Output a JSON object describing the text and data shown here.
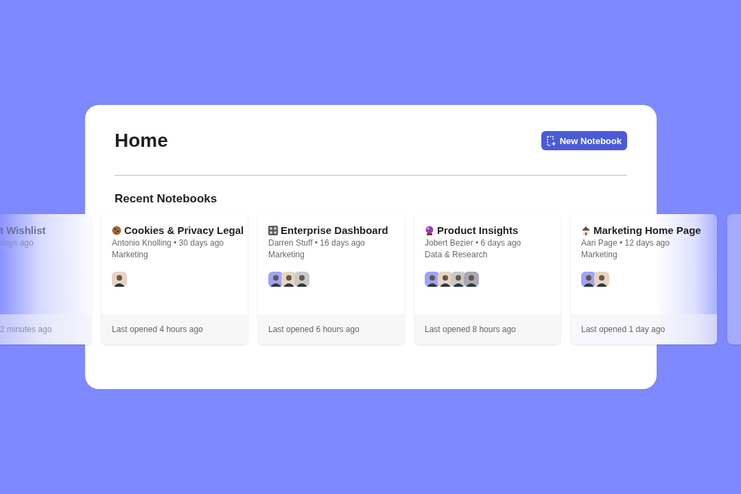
{
  "page": {
    "title": "Home",
    "new_button": "New Notebook"
  },
  "section_title": "Recent Notebooks",
  "notebooks": [
    {
      "kind": "partial-left",
      "title": "t Wishlist",
      "meta": "days ago",
      "opened": "2 minutes ago"
    },
    {
      "kind": "full",
      "title": "Cookies & Privacy Legal",
      "meta": "Antonio Knolling • 30 days ago",
      "team": "Marketing",
      "opened": "Last opened 4 hours ago",
      "avatars": [
        {
          "color": "#e6d5c3"
        }
      ]
    },
    {
      "kind": "full",
      "title": "Enterprise Dashboard",
      "meta": "Darren Stuff • 16 days ago",
      "team": "Marketing",
      "opened": "Last opened 6 hours ago",
      "avatars": [
        {
          "color": "#9ea4f5"
        },
        {
          "color": "#e6d5c3"
        },
        {
          "color": "#c9c9c9"
        }
      ]
    },
    {
      "kind": "full",
      "title": "Product Insights",
      "meta": "Jobert Bezier • 6 days ago",
      "team": "Data & Research",
      "opened": "Last opened 8 hours ago",
      "avatars": [
        {
          "color": "#9ea4f5"
        },
        {
          "color": "#e6d5c3"
        },
        {
          "color": "#c9c9c9"
        },
        {
          "color": "#a9a9b3"
        }
      ]
    },
    {
      "kind": "fade-right",
      "title": "Marketing Home Page",
      "meta": "Aari Page • 12 days ago",
      "team": "Marketing",
      "opened": "Last opened 1 day ago",
      "avatars": [
        {
          "color": "#9ea4f5"
        },
        {
          "color": "#e6d5c3"
        }
      ]
    },
    {
      "kind": "partial-right"
    }
  ]
}
